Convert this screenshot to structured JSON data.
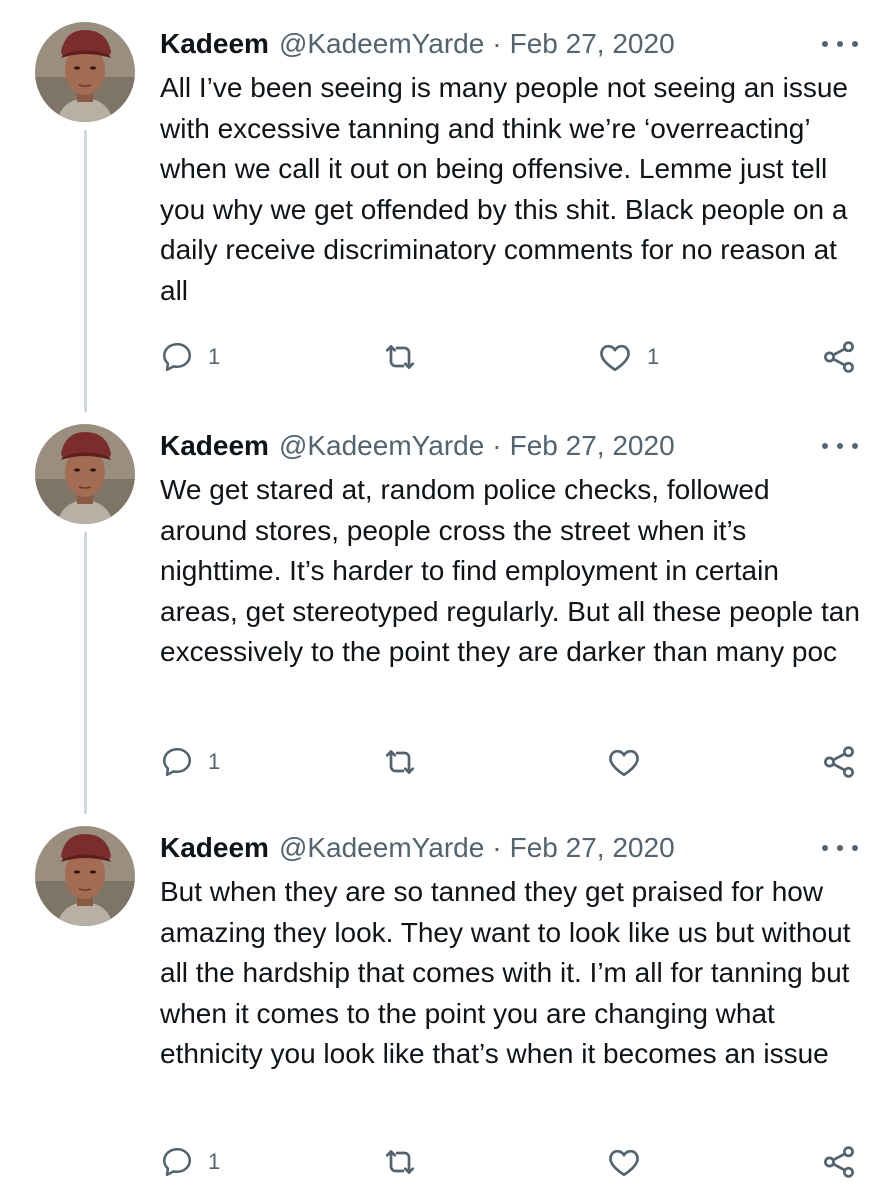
{
  "tweets": [
    {
      "name": "Kadeem",
      "handle": "@KadeemYarde",
      "separator": "·",
      "date": "Feb 27, 2020",
      "text": "All I’ve been seeing is many people not seeing an issue with excessive tanning and think we’re ‘overreacting’ when we call it out on being offensive. Lemme just tell you why we get offended by this shit. Black people on a daily receive discriminatory comments for no reason at all",
      "reply_count": "1",
      "retweet_count": "",
      "like_count": "1"
    },
    {
      "name": "Kadeem",
      "handle": "@KadeemYarde",
      "separator": "·",
      "date": "Feb 27, 2020",
      "text": "We get stared at, random police checks, followed around stores, people cross the street when it’s nighttime. It’s harder to find employment in certain areas, get stereotyped regularly. But all these people tan excessively to the point they are darker than many poc",
      "reply_count": "1",
      "retweet_count": "",
      "like_count": ""
    },
    {
      "name": "Kadeem",
      "handle": "@KadeemYarde",
      "separator": "·",
      "date": "Feb 27, 2020",
      "text": "But when they are so tanned they get praised for how amazing they look. They want to look like us but without all the hardship that comes with it. I’m all for tanning but when it comes to the point you are changing what ethnicity you look like that’s when it becomes an issue",
      "reply_count": "1",
      "retweet_count": "",
      "like_count": ""
    }
  ],
  "icons": {
    "reply": "reply-icon",
    "retweet": "retweet-icon",
    "like": "heart-icon",
    "share": "share-icon",
    "more": "more-icon"
  },
  "colors": {
    "text": "#0f1419",
    "secondary": "#536471",
    "thread_line": "#cfd9de",
    "background": "#ffffff"
  }
}
